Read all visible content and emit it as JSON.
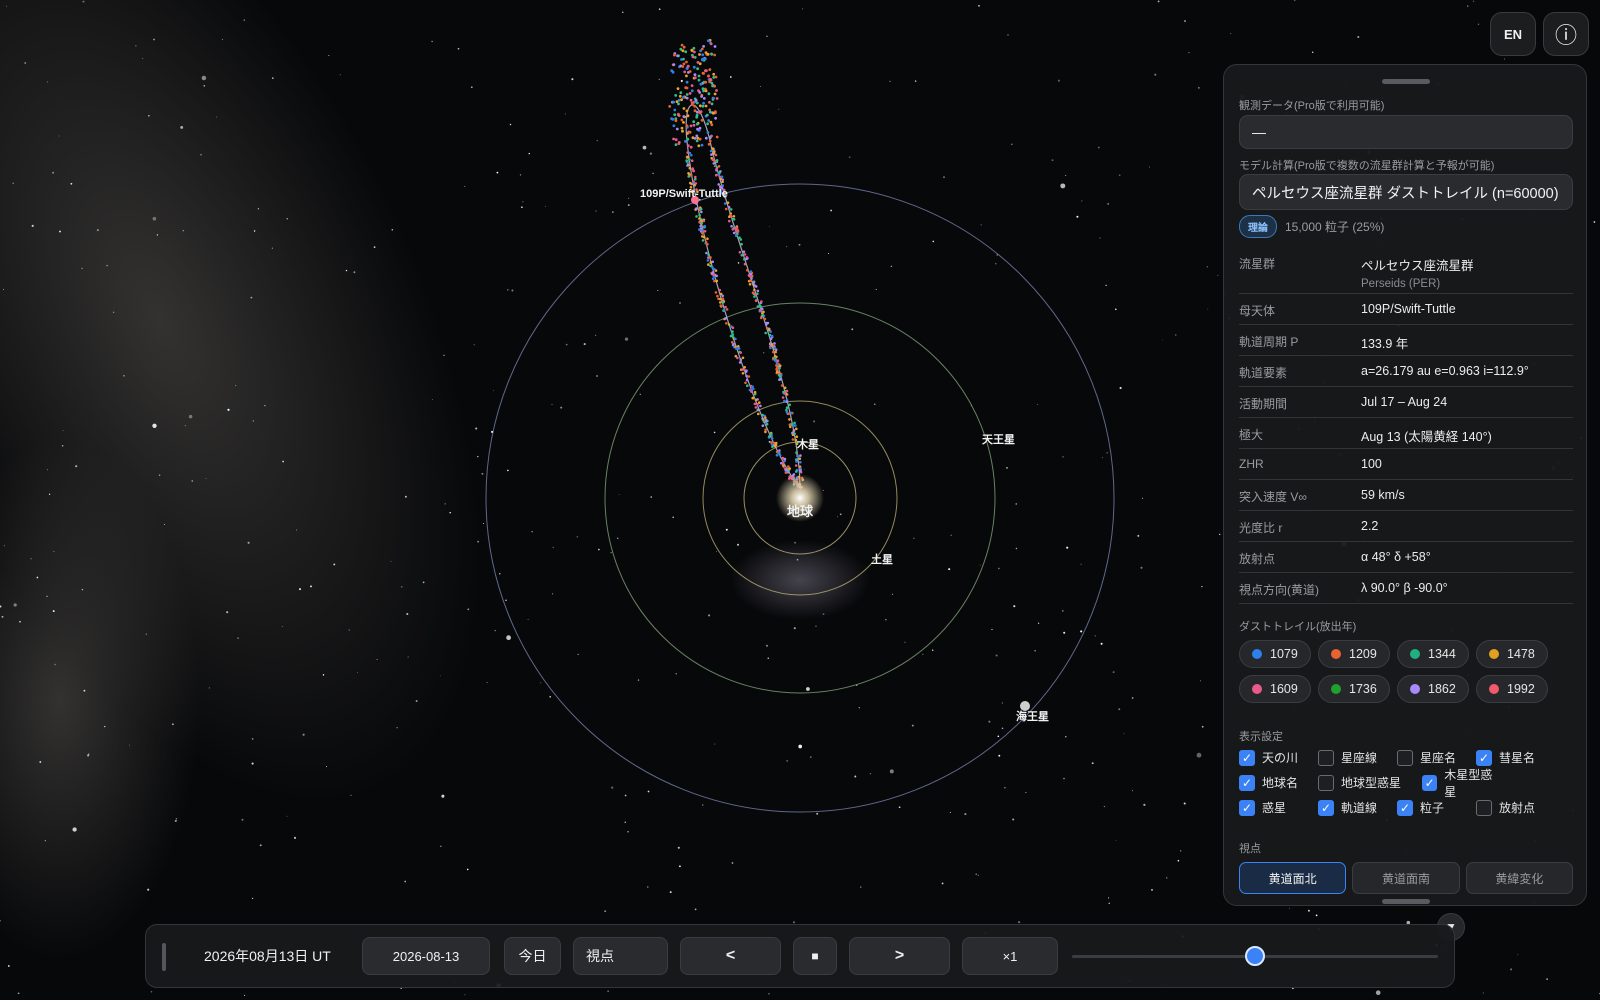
{
  "scene": {
    "labels": {
      "comet": "109P/Swift-Tuttle",
      "jupiter": "木星",
      "earth": "地球",
      "saturn": "土星",
      "uranus": "天王星",
      "neptune": "海王星"
    },
    "colors": {
      "stream_1": "#2f7fe8",
      "stream_2": "#e8632f",
      "stream_3": "#f0a32a",
      "stream_4": "#2fbf8a",
      "stream_5": "#e85a8a",
      "stream_6": "#a78bfa"
    }
  },
  "top_buttons": {
    "lang": "EN",
    "info": "ⓘ"
  },
  "panel": {
    "observation_label": "観測データ(Pro版で利用可能)",
    "observation_value": "—",
    "model_label": "モデル計算(Pro版で複数の流星群計算と予報が可能)",
    "model_value": "ペルセウス座流星群 ダストトレイル (n=60000)",
    "badge": "理論",
    "badge_note": "15,000 粒子 (25%)",
    "info": [
      {
        "key": "流星群",
        "value": "ペルセウス座流星群",
        "sub": "Perseids (PER)"
      },
      {
        "key": "母天体",
        "value": "109P/Swift-Tuttle"
      },
      {
        "key": "軌道周期 P",
        "value": "133.9 年"
      },
      {
        "key": "軌道要素",
        "value": "a=26.179 au e=0.963 i=112.9°"
      },
      {
        "key": "活動期間",
        "value": "Jul 17 – Aug 24"
      },
      {
        "key": "極大",
        "value": "Aug 13 (太陽黄経 140°)"
      },
      {
        "key": "ZHR",
        "value": "100"
      },
      {
        "key": "突入速度 V∞",
        "value": "59 km/s"
      },
      {
        "key": "光度比 r",
        "value": "2.2"
      },
      {
        "key": "放射点",
        "value": "α 48° δ +58°"
      },
      {
        "key": "視点方向(黄道)",
        "value": "λ 90.0° β -90.0°"
      }
    ],
    "trails_label": "ダストトレイル(放出年)",
    "trails": [
      {
        "year": "1079",
        "color": "#2f7fe8"
      },
      {
        "year": "1209",
        "color": "#e8632f"
      },
      {
        "year": "1344",
        "color": "#20b080"
      },
      {
        "year": "1478",
        "color": "#e0a020"
      },
      {
        "year": "1609",
        "color": "#e85a8a"
      },
      {
        "year": "1736",
        "color": "#1fa02a"
      },
      {
        "year": "1862",
        "color": "#a78bfa"
      },
      {
        "year": "1992",
        "color": "#f05a6a"
      }
    ],
    "display_label": "表示設定",
    "display_rows": [
      [
        {
          "label": "天の川",
          "checked": true
        },
        {
          "label": "星座線",
          "checked": false
        },
        {
          "label": "星座名",
          "checked": false
        },
        {
          "label": "彗星名",
          "checked": true
        }
      ],
      [
        {
          "label": "地球名",
          "checked": true
        },
        {
          "label": "地球型惑星",
          "checked": false
        },
        {
          "label": "木星型惑星",
          "checked": true
        }
      ],
      [
        {
          "label": "惑星",
          "checked": true
        },
        {
          "label": "軌道線",
          "checked": true
        },
        {
          "label": "粒子",
          "checked": true
        },
        {
          "label": "放射点",
          "checked": false
        }
      ]
    ],
    "view_label": "視点",
    "view_buttons": [
      {
        "label": "黄道面北",
        "active": true
      },
      {
        "label": "黄道面南",
        "active": false
      },
      {
        "label": "黄緯変化",
        "active": false
      }
    ]
  },
  "collapse": "▼",
  "bottom_bar": {
    "date_text": "2026年08月13日 UT",
    "date_input": "2026-08-13",
    "today": "今日",
    "view_select": "視点",
    "prev": "<",
    "stop": "■",
    "next": ">",
    "speed": "×1",
    "slider_fraction": 0.5
  }
}
